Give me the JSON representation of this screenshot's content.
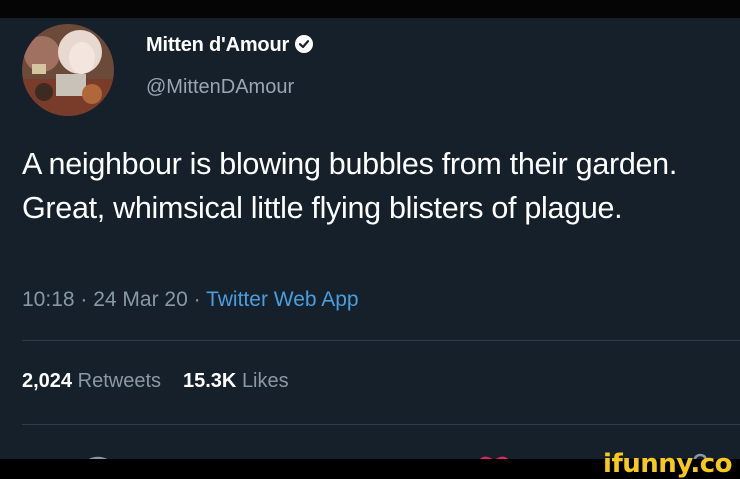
{
  "author": {
    "display_name": "Mitten d'Amour",
    "handle": "@MittenDAmour",
    "verified": true,
    "avatar_icon": "profile-photo"
  },
  "tweet": {
    "text": "A neighbour is blowing bubbles from their garden. Great, whimsical little flying blisters of plague.",
    "time": "10:18",
    "date": "24 Mar 20",
    "separator": " · ",
    "source": "Twitter Web App"
  },
  "stats": {
    "retweets_count": "2,024",
    "retweets_label": "Retweets",
    "likes_count": "15.3K",
    "likes_label": "Likes"
  },
  "actions": [
    "reply-icon",
    "retweet-icon",
    "like-icon",
    "share-icon"
  ],
  "watermark": "ifunny.co",
  "colors": {
    "background": "#15202b",
    "text": "#ffffff",
    "muted": "#8899a6",
    "link": "#4a9ee0",
    "like": "#e0245e",
    "watermark": "#f7c91a"
  }
}
